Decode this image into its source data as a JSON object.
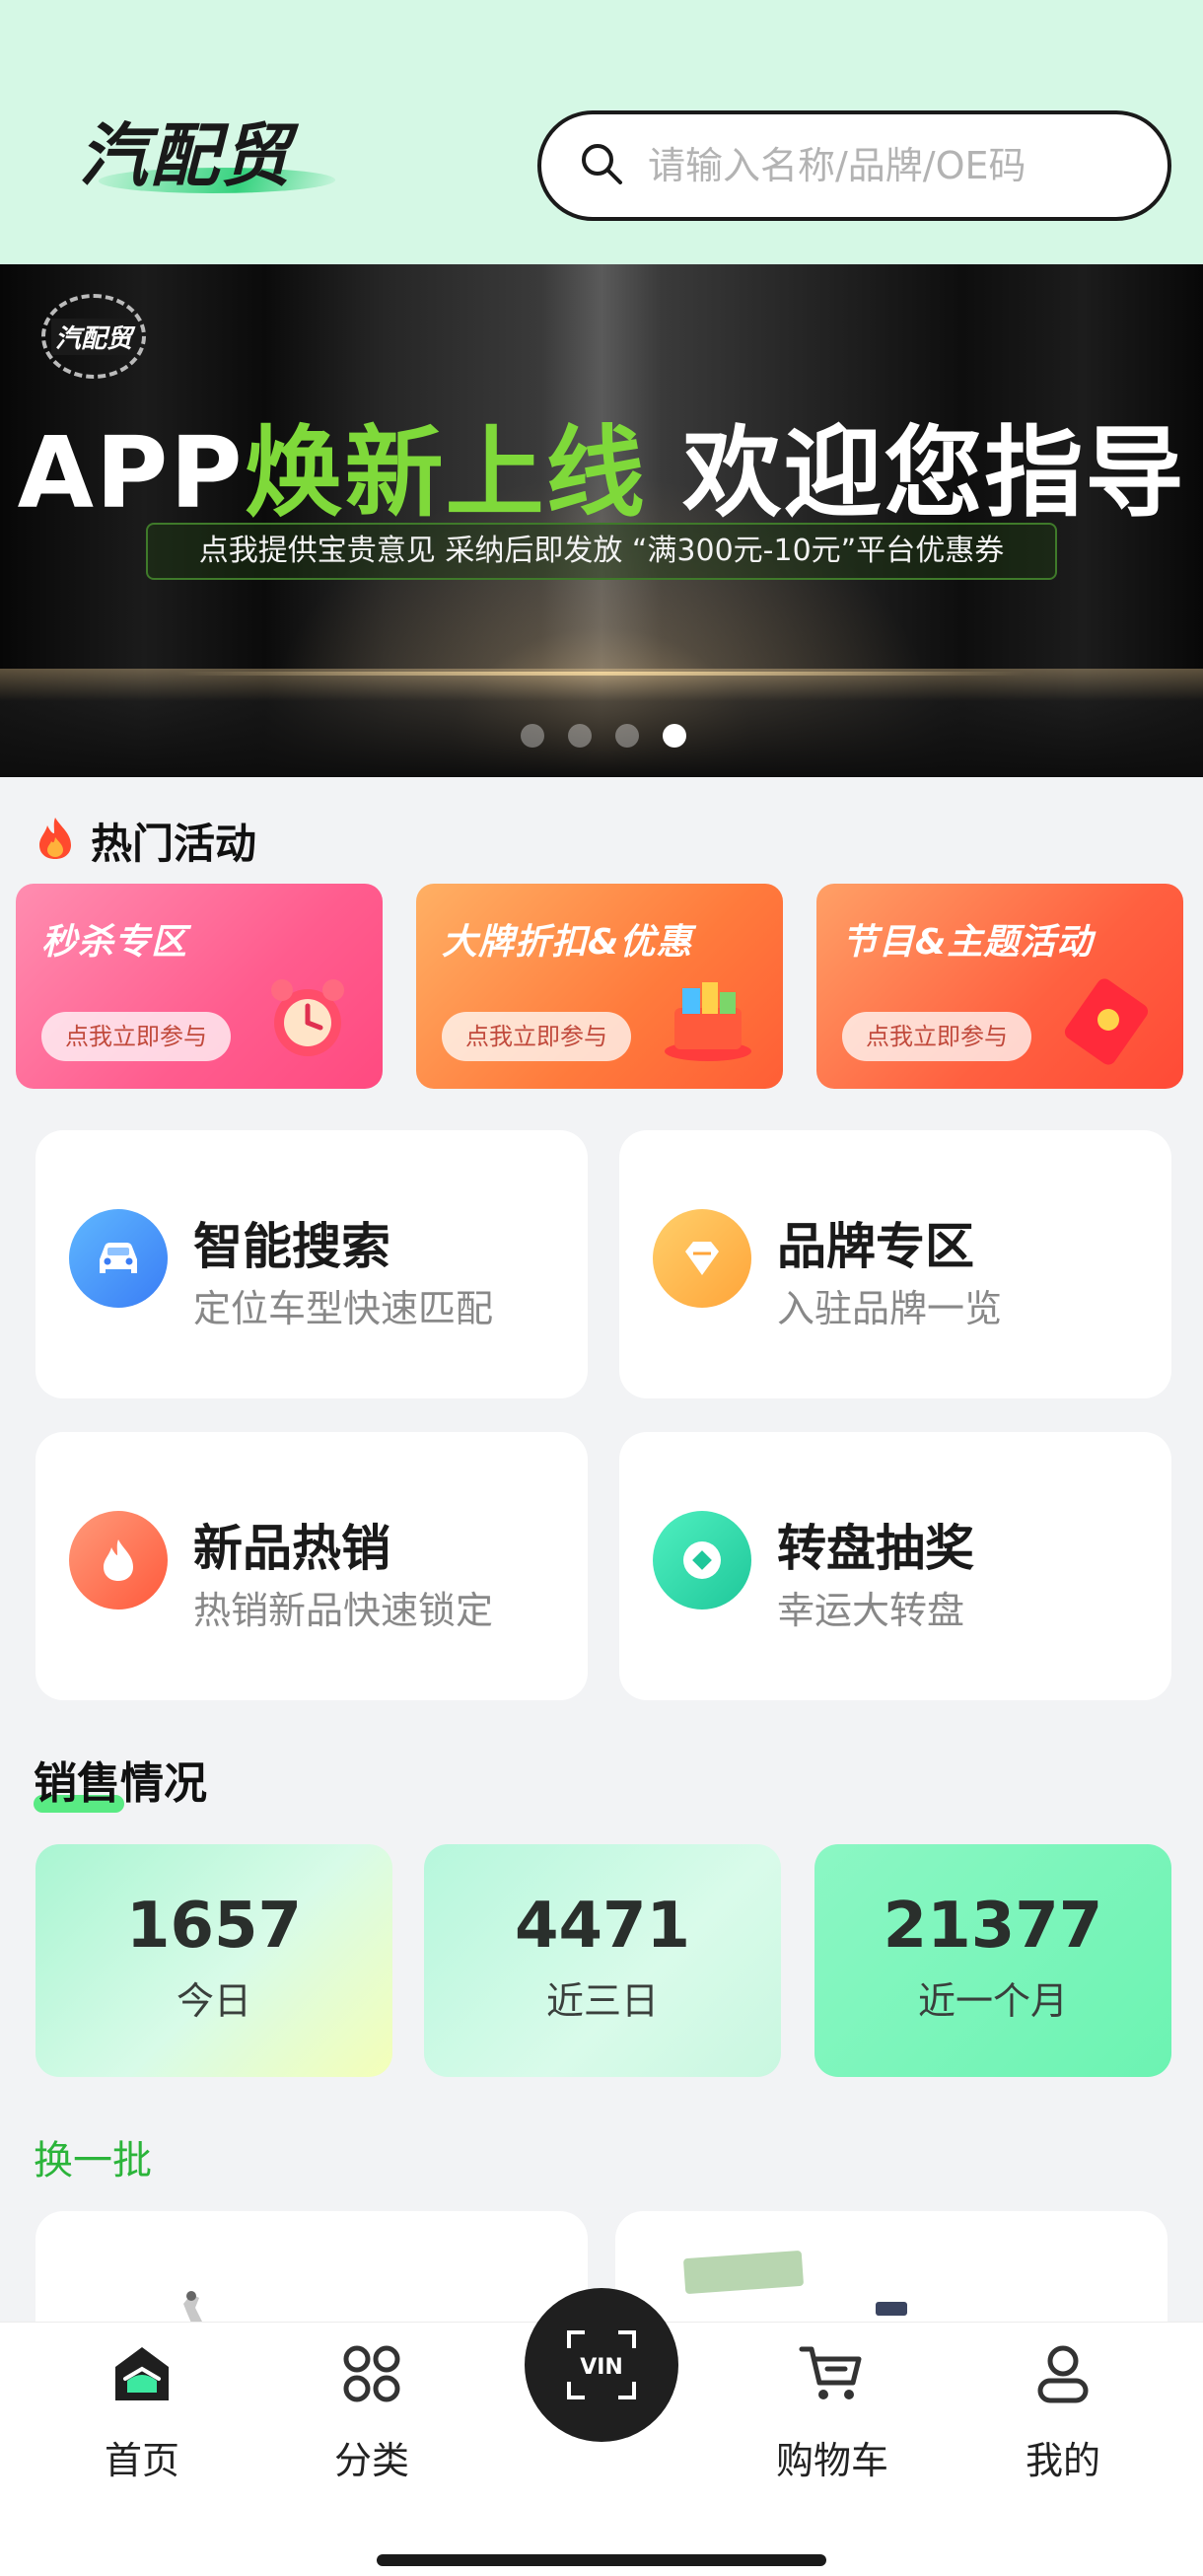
{
  "header": {
    "logo_text": "汽配贸",
    "search_placeholder": "请输入名称/品牌/OE码"
  },
  "banner": {
    "badge_text": "汽配贸",
    "title_prefix": "APP",
    "title_green": "焕新上线",
    "title_suffix": "欢迎您指导",
    "subtitle": "点我提供宝贵意见 采纳后即发放 “满300元-10元”平台优惠券",
    "dots_total": 4,
    "active_dot": 4
  },
  "hot": {
    "title": "热门活动",
    "promos": [
      {
        "title": "秒杀专区",
        "button": "点我立即参与",
        "icon": "alarm-clock-icon"
      },
      {
        "title": "大牌折扣&优惠",
        "button": "点我立即参与",
        "icon": "gift-box-icon"
      },
      {
        "title": "节目&主题活动",
        "button": "点我立即参与",
        "icon": "red-envelope-icon"
      }
    ]
  },
  "features": [
    {
      "title": "智能搜索",
      "desc": "定位车型快速匹配",
      "icon": "car-icon"
    },
    {
      "title": "品牌专区",
      "desc": "入驻品牌一览",
      "icon": "diamond-icon"
    },
    {
      "title": "新品热销",
      "desc": "热销新品快速锁定",
      "icon": "flame-icon"
    },
    {
      "title": "转盘抽奖",
      "desc": "幸运大转盘",
      "icon": "wheel-icon"
    }
  ],
  "sales": {
    "title": "销售情况",
    "stats": [
      {
        "value": "1657",
        "label": "今日"
      },
      {
        "value": "4471",
        "label": "近三日"
      },
      {
        "value": "21377",
        "label": "近一个月"
      }
    ]
  },
  "refresh_label": "换一批",
  "tabbar": {
    "items": [
      {
        "label": "首页",
        "icon": "home-icon"
      },
      {
        "label": "分类",
        "icon": "grid-icon"
      },
      {
        "label": "购物车",
        "icon": "cart-icon"
      },
      {
        "label": "我的",
        "icon": "user-icon"
      }
    ],
    "vin_label": "VIN"
  },
  "colors": {
    "header_bg": "#d5f8e5",
    "accent_green": "#7fd93a",
    "refresh_green": "#2bb43a",
    "page_bg": "#f2f3f5"
  }
}
